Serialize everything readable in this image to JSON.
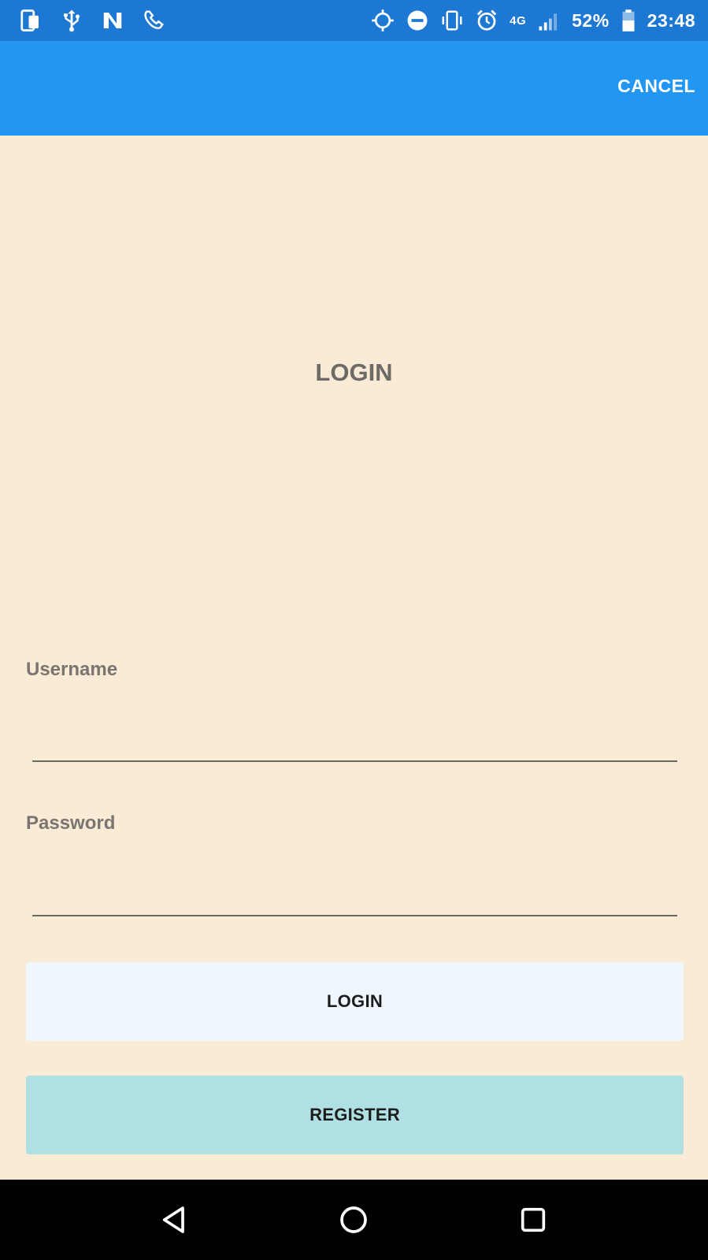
{
  "status_bar": {
    "battery": "52%",
    "time": "23:48",
    "network": "4G",
    "icons_left": [
      "phone-icon",
      "usb-icon",
      "n-app-icon",
      "phone-call-icon"
    ],
    "icons_right": [
      "location-icon",
      "do-not-disturb-icon",
      "vibrate-icon",
      "alarm-icon",
      "network-4g-icon",
      "signal-icon",
      "battery-icon"
    ]
  },
  "app_bar": {
    "cancel_label": "CANCEL",
    "background": "#2196f3"
  },
  "page": {
    "title": "LOGIN",
    "background": "#faebd7"
  },
  "form": {
    "username_label": "Username",
    "username_value": "",
    "password_label": "Password",
    "password_value": ""
  },
  "buttons": {
    "login_label": "LOGIN",
    "login_color": "#f0f6fe",
    "register_label": "REGISTER",
    "register_color": "#b0dfe4"
  },
  "nav_bar": {
    "buttons": [
      "back-icon",
      "home-icon",
      "recents-icon"
    ]
  }
}
